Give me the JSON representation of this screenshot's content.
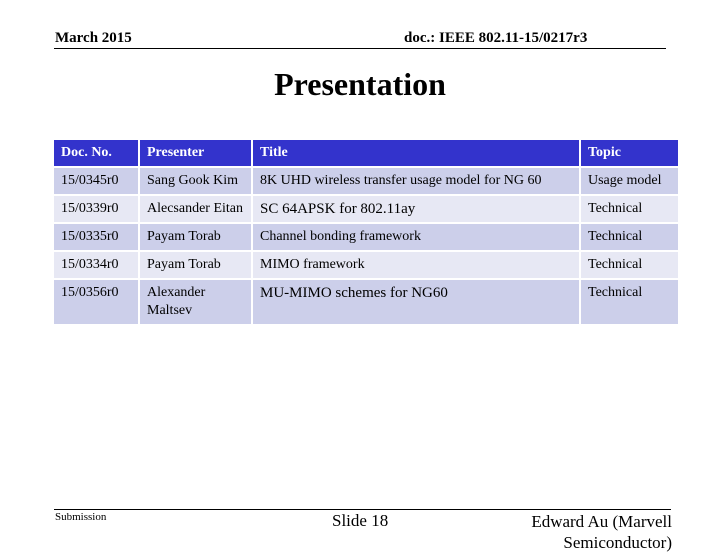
{
  "header": {
    "date": "March 2015",
    "doc_id": "doc.: IEEE 802.11-15/0217r3"
  },
  "slide_title": "Presentation",
  "table": {
    "columns": [
      "Doc. No.",
      "Presenter",
      "Title",
      "Topic"
    ],
    "rows": [
      {
        "doc_no": "15/0345r0",
        "presenter": "Sang Gook Kim",
        "title": "8K UHD wireless transfer usage model for NG 60",
        "topic": "Usage model"
      },
      {
        "doc_no": "15/0339r0",
        "presenter": "Alecsander Eitan",
        "title": "SC 64APSK for 802.11ay",
        "topic": "Technical"
      },
      {
        "doc_no": "15/0335r0",
        "presenter": "Payam Torab",
        "title": "Channel bonding framework",
        "topic": "Technical"
      },
      {
        "doc_no": "15/0334r0",
        "presenter": "Payam Torab",
        "title": "MIMO framework",
        "topic": "Technical"
      },
      {
        "doc_no": "15/0356r0",
        "presenter": "Alexander Maltsev",
        "title": "MU-MIMO schemes for NG60",
        "topic": "Technical"
      }
    ]
  },
  "footer": {
    "left": "Submission",
    "center": "Slide 18",
    "right_line1": "Edward Au (Marvell",
    "right_line2": "Semiconductor)"
  },
  "colors": {
    "header_bg": "#3333cc",
    "row_odd_bg": "#cccfea",
    "row_even_bg": "#e7e8f4"
  }
}
